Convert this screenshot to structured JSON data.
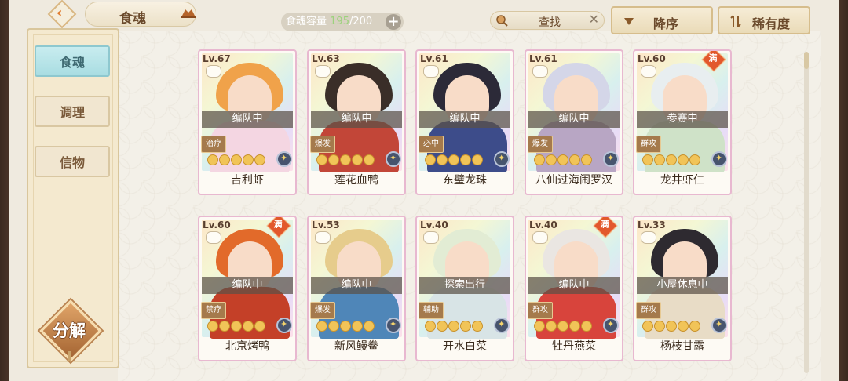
{
  "header": {
    "title": "食魂",
    "capacity_label": "食魂容量",
    "capacity_current": "195",
    "capacity_max": "/200",
    "capacity_plus": "+",
    "search_label": "查找",
    "search_clear": "✕",
    "sort_order_label": "降序",
    "sort_by_label": "稀有度"
  },
  "sidebar": {
    "items": [
      {
        "label": "食魂",
        "active": true
      },
      {
        "label": "调理",
        "active": false
      },
      {
        "label": "信物",
        "active": false
      }
    ],
    "decompose_label": "分解"
  },
  "cards": [
    {
      "level": "Lv.67",
      "status": "编队中",
      "role": "治疗",
      "stars": 5,
      "name": "吉利虾",
      "full": false,
      "hair": "#f0a24a",
      "body": "#f4d6e2"
    },
    {
      "level": "Lv.63",
      "status": "编队中",
      "role": "爆发",
      "stars": 5,
      "name": "莲花血鸭",
      "full": false,
      "hair": "#3a2e28",
      "body": "#c24638"
    },
    {
      "level": "Lv.61",
      "status": "编队中",
      "role": "必中",
      "stars": 5,
      "name": "东璧龙珠",
      "full": false,
      "hair": "#2c2a38",
      "body": "#3d4c8a"
    },
    {
      "level": "Lv.61",
      "status": "编队中",
      "role": "爆发",
      "stars": 5,
      "name": "八仙过海闹罗汉",
      "full": false,
      "hair": "#d4d6e8",
      "body": "#b8a6c4"
    },
    {
      "level": "Lv.60",
      "status": "参赛中",
      "role": "群攻",
      "stars": 5,
      "name": "龙井虾仁",
      "full": true,
      "hair": "#e8eef0",
      "body": "#cfe2c8"
    },
    {
      "level": "Lv.60",
      "status": "编队中",
      "role": "禁疗",
      "stars": 5,
      "name": "北京烤鸭",
      "full": true,
      "hair": "#e26a2a",
      "body": "#c44028"
    },
    {
      "level": "Lv.53",
      "status": "编队中",
      "role": "爆发",
      "stars": 5,
      "name": "新风鳗鲞",
      "full": false,
      "hair": "#e6cc8c",
      "body": "#4f86b8"
    },
    {
      "level": "Lv.40",
      "status": "探索出行",
      "role": "辅助",
      "stars": 5,
      "name": "开水白菜",
      "full": false,
      "hair": "#e2ecd4",
      "body": "#d8e4e6"
    },
    {
      "level": "Lv.40",
      "status": "编队中",
      "role": "群攻",
      "stars": 5,
      "name": "牡丹燕菜",
      "full": true,
      "hair": "#eae6e2",
      "body": "#d8443c"
    },
    {
      "level": "Lv.33",
      "status": "小屋休息中",
      "role": "群攻",
      "stars": 5,
      "name": "杨枝甘露",
      "full": false,
      "hair": "#2e2a30",
      "body": "#e8dcc6"
    }
  ],
  "full_badge_label": "满",
  "colors": {
    "accent": "#e07a2c",
    "active_tab": "#a9dde2",
    "card_border": "#e8b8d0"
  }
}
